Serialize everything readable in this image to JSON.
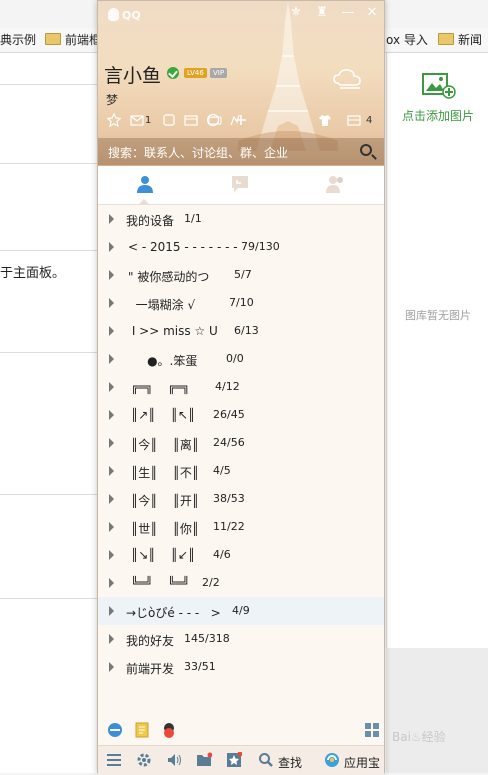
{
  "browser": {
    "bookmarks": [
      {
        "label": "典示例",
        "folder": false
      },
      {
        "label": "前端框",
        "folder": true
      },
      {
        "label": "ox 导入",
        "folder": false
      },
      {
        "label": "新闻",
        "folder": true
      }
    ],
    "page_text": "于主面板。",
    "right_panel": {
      "add_picture": "点击添加图片",
      "no_picture": "图库暂无图片"
    },
    "watermark": "Bai♨经验"
  },
  "qq": {
    "title": "QQ",
    "nickname": "言小鱼",
    "level_badge": "LV46",
    "vip_badge": "VIP",
    "signature": "梦",
    "toolbar": {
      "mail_count": "1",
      "box_count": "4"
    },
    "search_placeholder": "搜索：联系人、讨论组、群、企业",
    "groups": [
      {
        "name": "我的设备",
        "count": "1/1"
      },
      {
        "name": "< - 2015 - - - - - - -",
        "count": "79/130"
      },
      {
        "name": "\" 被你感动的つ",
        "count": "5/7"
      },
      {
        "name": "  一塌糊涂 √",
        "count": "7/10"
      },
      {
        "name": " I >> miss ☆ U",
        "count": "6/13"
      },
      {
        "name": "     ●。.笨蛋",
        "count": "0/0"
      },
      {
        "name": "╔═╗    ╔═╗",
        "count": "4/12"
      },
      {
        "name": "║↗║    ║↖║",
        "count": "26/45"
      },
      {
        "name": "║今║    ║离║",
        "count": "24/56"
      },
      {
        "name": "║生║    ║不║",
        "count": "4/5"
      },
      {
        "name": "║今║    ║开║",
        "count": "38/53"
      },
      {
        "name": "║世║    ║你║",
        "count": "11/22"
      },
      {
        "name": "║↘║    ║↙║",
        "count": "4/6"
      },
      {
        "name": "╚═╝    ╚═╝",
        "count": "2/2"
      },
      {
        "name": "→じòぴé - - -   >",
        "count": "4/9"
      },
      {
        "name": "我的好友",
        "count": "145/318"
      },
      {
        "name": "前端开发",
        "count": "33/51"
      }
    ],
    "bottom": {
      "find": "查找",
      "app_store": "应用宝"
    }
  },
  "colors": {
    "accent_green": "#3a9a40",
    "online_green": "#39a83a",
    "level_gold": "#e1a325"
  }
}
